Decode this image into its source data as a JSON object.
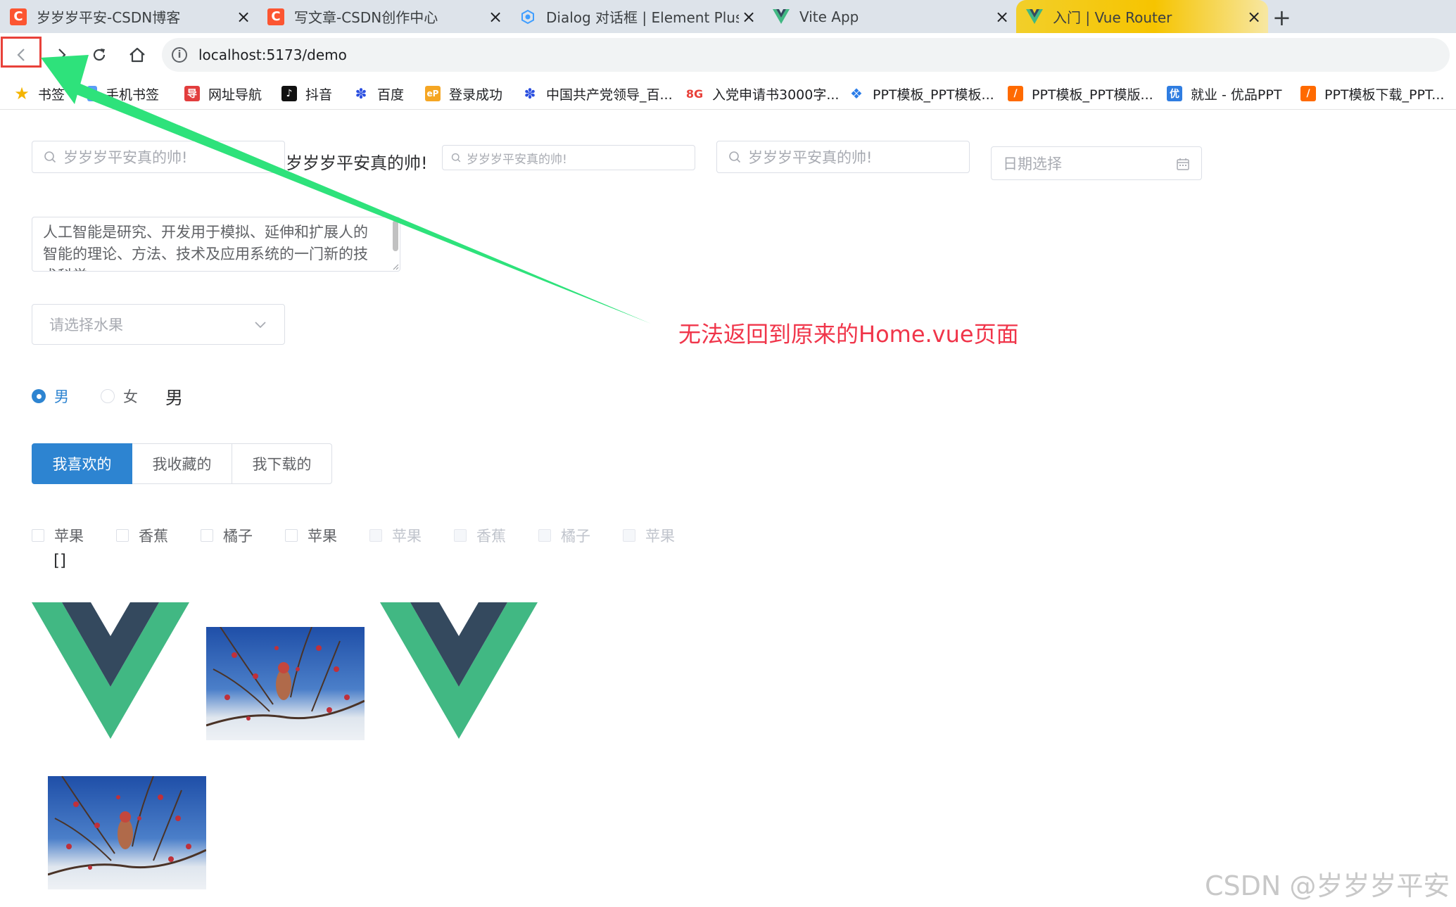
{
  "browser": {
    "tabs": [
      {
        "title": "岁岁岁平安-CSDN博客",
        "favicon": "csdn-icon"
      },
      {
        "title": "写文章-CSDN创作中心",
        "favicon": "csdn-icon"
      },
      {
        "title": "Dialog 对话框 | Element Plus",
        "favicon": "element-plus-icon"
      },
      {
        "title": "Vite App",
        "favicon": "vue-icon"
      },
      {
        "title": "入门 | Vue Router",
        "favicon": "vue-icon",
        "active": true
      }
    ],
    "url": "localhost:5173/demo",
    "bookmarks": [
      {
        "label": "书签",
        "icon": "star-icon"
      },
      {
        "label": "手机书签",
        "icon": "phone-icon"
      },
      {
        "label": "网址导航",
        "icon": "nav-icon"
      },
      {
        "label": "抖音",
        "icon": "douyin-icon"
      },
      {
        "label": "百度",
        "icon": "baidu-icon"
      },
      {
        "label": "登录成功",
        "icon": "ep-icon"
      },
      {
        "label": "中国共产党领导_百...",
        "icon": "baidu-icon"
      },
      {
        "label": "入党申请书3000字...",
        "icon": "8g-icon"
      },
      {
        "label": "PPT模板_PPT模板...",
        "icon": "ppt-icon"
      },
      {
        "label": "PPT模板_PPT模版...",
        "icon": "ppt-orange-icon"
      },
      {
        "label": "就业 - 优品PPT",
        "icon": "youpin-icon"
      },
      {
        "label": "PPT模板下载_PPT...",
        "icon": "ppt-orange-icon"
      }
    ]
  },
  "page": {
    "input1_placeholder": "岁岁岁平安真的帅!",
    "bound_text": "岁岁岁平安真的帅!",
    "input2_placeholder": "岁岁岁平安真的帅!",
    "input3_placeholder": "岁岁岁平安真的帅!",
    "date_placeholder": "日期选择",
    "textarea_text": "人工智能是研究、开发用于模拟、延伸和扩展人的智能的理论、方法、技术及应用系统的一门新的技术科学",
    "select_placeholder": "请选择水果",
    "radio": {
      "options": [
        "男",
        "女"
      ],
      "selected": "男",
      "value_text": "男"
    },
    "button_group": [
      "我喜欢的",
      "我收藏的",
      "我下载的"
    ],
    "checkboxes": [
      "苹果",
      "香蕉",
      "橘子",
      "苹果"
    ],
    "checkboxes_disabled": [
      "苹果",
      "香蕉",
      "橘子",
      "苹果"
    ],
    "checked_value": "[]"
  },
  "annotation": "无法返回到原来的Home.vue页面",
  "watermark": "CSDN @岁岁岁平安",
  "colors": {
    "primary": "#2d84d1",
    "vue_green": "#41b883",
    "vue_dark": "#34495e",
    "annotation": "#f0354a",
    "arrow": "#2ee27b"
  }
}
